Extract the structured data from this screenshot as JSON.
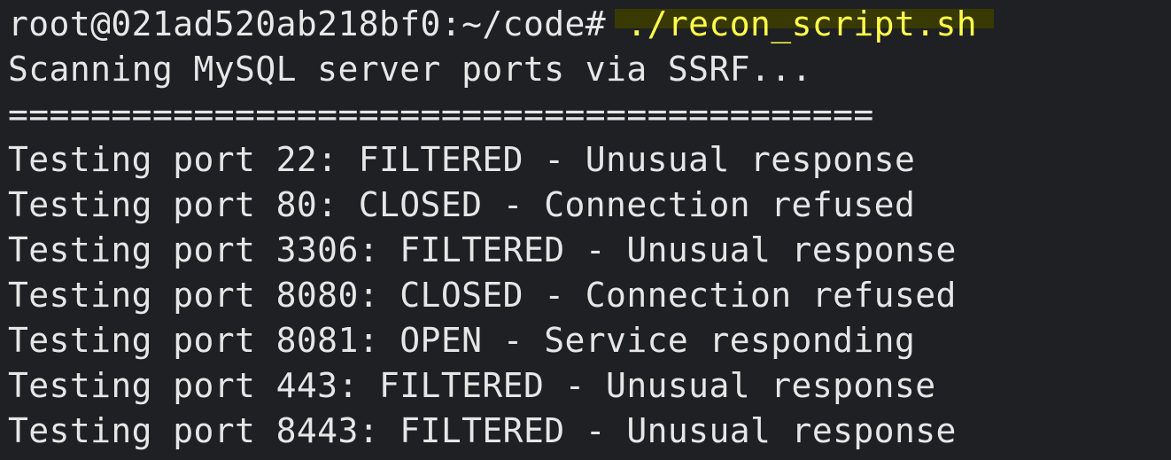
{
  "terminal": {
    "prompt": "root@021ad520ab218bf0:~/code# ",
    "command": "./recon_script.sh",
    "highlight_color": "#3b3c00",
    "command_color": "#ffff4a",
    "lines": [
      "Scanning MySQL server ports via SSRF...",
      "==========================================",
      "Testing port 22: FILTERED - Unusual response",
      "Testing port 80: CLOSED - Connection refused",
      "Testing port 3306: FILTERED - Unusual response",
      "Testing port 8080: CLOSED - Connection refused",
      "Testing port 8081: OPEN - Service responding",
      "Testing port 443: FILTERED - Unusual response",
      "Testing port 8443: FILTERED - Unusual response"
    ]
  }
}
